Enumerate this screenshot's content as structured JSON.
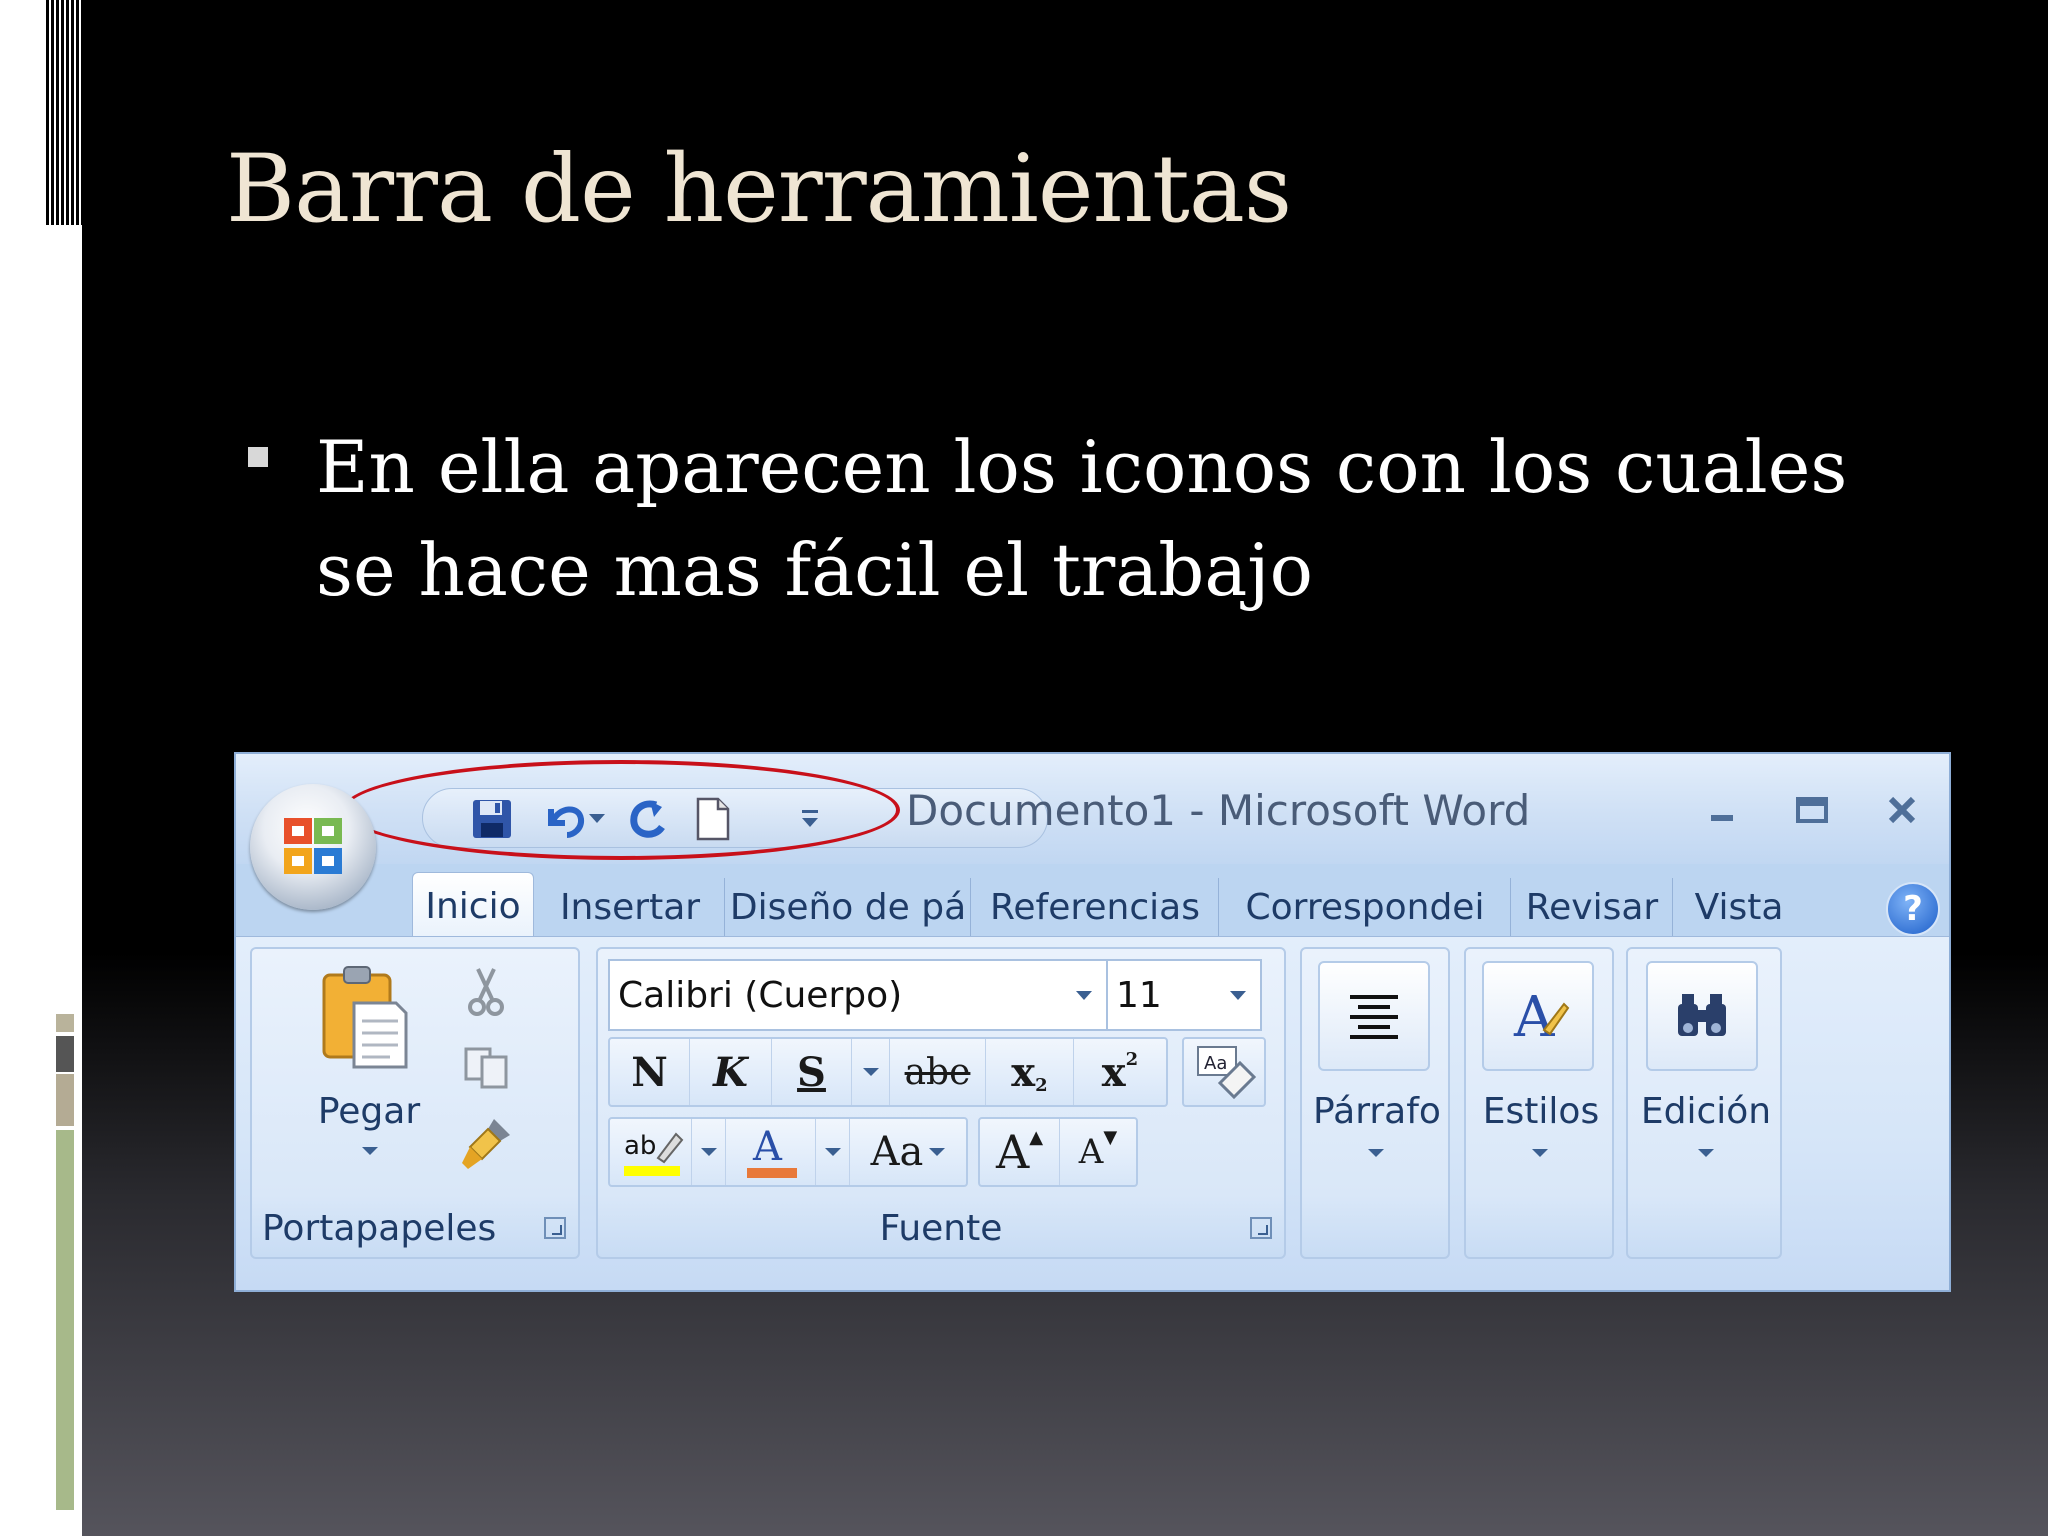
{
  "slide": {
    "title": "Barra de herramientas",
    "bullet": "En ella aparecen los iconos con los cuales se hace mas fácil el trabajo"
  },
  "word": {
    "window_title": "Documento1 - Microsoft Word",
    "quick_access": [
      "save-icon",
      "undo-icon",
      "redo-icon",
      "new-document-icon",
      "customize-qat-icon"
    ],
    "window_controls": [
      "minimize-icon",
      "maximize-icon",
      "close-icon"
    ],
    "tabs": [
      "Inicio",
      "Insertar",
      "Diseño de pá",
      "Referencias",
      "Correspondei",
      "Revisar",
      "Vista"
    ],
    "active_tab": "Inicio",
    "groups": {
      "clipboard": {
        "label": "Portapapeles",
        "paste_label": "Pegar"
      },
      "font": {
        "label": "Fuente",
        "font_name": "Calibri (Cuerpo)",
        "font_size": "11",
        "bold": "N",
        "italic": "K",
        "underline": "S",
        "strike": "abe",
        "subscript": "x",
        "superscript": "x",
        "change_case": "Aa",
        "grow": "A",
        "shrink": "A"
      },
      "paragraph": {
        "label": "Párrafo"
      },
      "styles": {
        "label": "Estilos"
      },
      "editing": {
        "label": "Edición"
      }
    },
    "colors": {
      "highlight": "#ffff00",
      "font_color": "#e8793a",
      "annotation_oval": "#c8101a"
    }
  }
}
